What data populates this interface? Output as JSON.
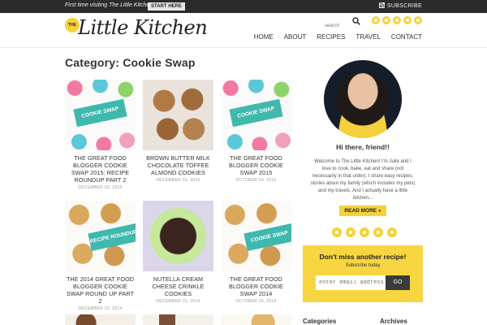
{
  "topbar": {
    "first_time": "First time visiting The Little Kitchen?",
    "start_here": "START HERE",
    "subscribe": "SUBSCRIBE"
  },
  "header": {
    "logo_badge": "THE",
    "logo_text": "Little Kitchen",
    "search_placeholder": "search",
    "social_icons": [
      "instagram-icon",
      "twitter-icon",
      "facebook-icon",
      "pinterest-icon",
      "email-icon"
    ],
    "nav": [
      "HOME",
      "ABOUT",
      "RECIPES",
      "TRAVEL",
      "CONTACT"
    ]
  },
  "main": {
    "title": "Category: Cookie Swap",
    "posts": [
      {
        "title": "THE GREAT FOOD BLOGGER COOKIE SWAP 2015: RECIPE ROUNDUP PART 2",
        "date": "DECEMBER 20, 2015",
        "thumb_text": "COOKIE SWAP"
      },
      {
        "title": "BROWN BUTTER MILK CHOCOLATE TOFFEE ALMOND COOKIES",
        "date": "DECEMBER 16, 2015",
        "thumb_text": ""
      },
      {
        "title": "THE GREAT FOOD BLOGGER COOKIE SWAP 2015",
        "date": "OCTOBER 20, 2015",
        "thumb_text": "COOKIE SWAP"
      },
      {
        "title": "THE 2014 GREAT FOOD BLOGGER COOKIE SWAP ROUND UP PART 2",
        "date": "DECEMBER 20, 2014",
        "thumb_text": "RECIPE ROUNDUP"
      },
      {
        "title": "NUTELLA CREAM CHEESE CRINKLE COOKIES",
        "date": "DECEMBER 15, 2014",
        "thumb_text": ""
      },
      {
        "title": "THE GREAT FOOD BLOGGER COOKIE SWAP 2014",
        "date": "OCTOBER 26, 2014",
        "thumb_text": "COOKIE SWAP"
      }
    ]
  },
  "sidebar": {
    "greeting": "Hi there, friend!!",
    "bio": "Welcome to The Little Kitchen! I'm Julie and I love to cook, bake, eat and share (not necessarily in that order). I share easy recipes, stories about my family (which includes my pets) and my travels. And I actually have a little kitchen...",
    "read_more": "READ MORE »",
    "signup_heading": "Don't miss another recipe!",
    "signup_sub": "Subscribe today",
    "email_placeholder": "enter email address",
    "go": "GO",
    "categories": "Categories",
    "archives": "Archives"
  },
  "colors": {
    "accent": "#f4d13d",
    "topbar": "#2b2b2b",
    "signup_bg": "#f7d642"
  }
}
